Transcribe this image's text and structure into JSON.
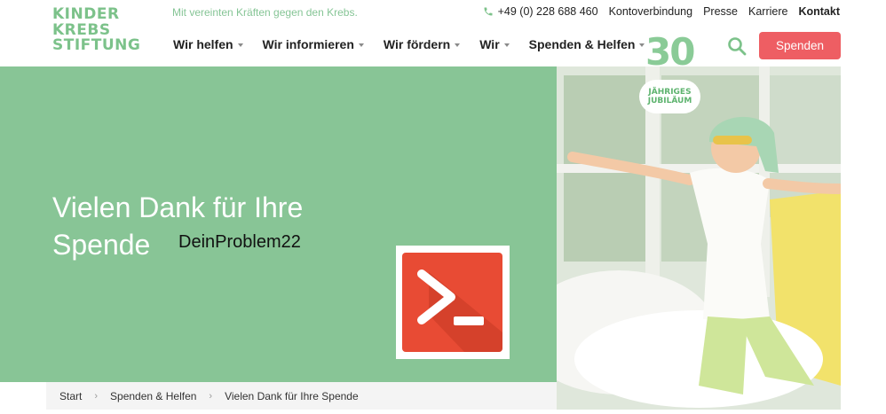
{
  "header": {
    "logo": [
      "KINDER",
      "KREBS",
      "STIFTUNG"
    ],
    "tagline": "Mit vereinten Kräften gegen den Krebs.",
    "topbar": {
      "phone": "+49 (0) 228 688 460",
      "links": [
        "Kontoverbindung",
        "Presse",
        "Karriere"
      ],
      "contact": "Kontakt"
    },
    "nav": [
      "Wir helfen",
      "Wir informieren",
      "Wir fördern",
      "Wir",
      "Spenden & Helfen"
    ],
    "donate_label": "Spenden",
    "jubilee": {
      "number": "30",
      "line1": "JÄHRIGES",
      "line2": "JUBILÄUM"
    }
  },
  "hero": {
    "title": "Vielen Dank für Ihre Spende",
    "overlay_text": "DeinProblem22"
  },
  "breadcrumb": [
    "Start",
    "Spenden & Helfen",
    "Vielen Dank für Ihre Spende"
  ],
  "colors": {
    "brand_green": "#88c596",
    "accent_red": "#ee5e63",
    "ps_red": "#e84b34"
  }
}
